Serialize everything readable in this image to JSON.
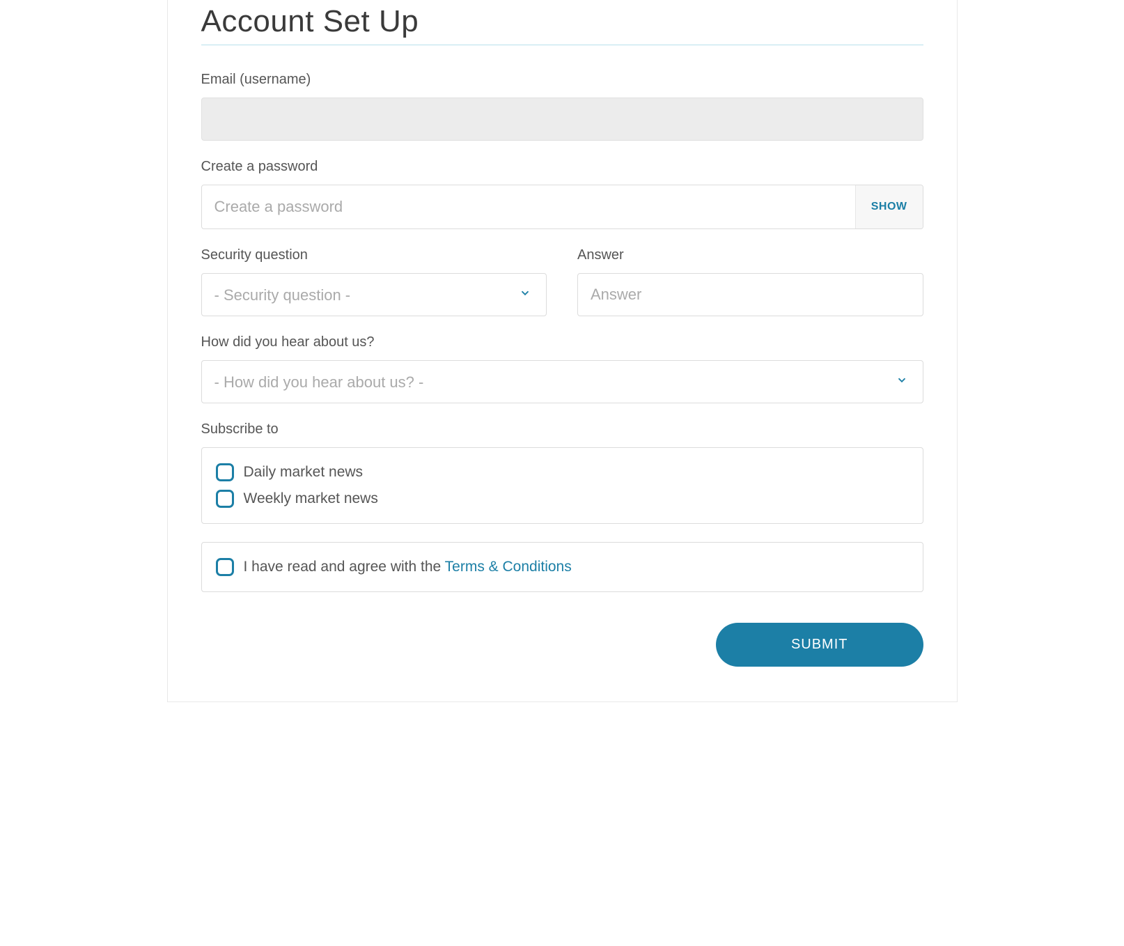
{
  "title": "Account Set Up",
  "email": {
    "label": "Email (username)",
    "value": ""
  },
  "password": {
    "label": "Create a password",
    "placeholder": "Create a password",
    "show_button": "SHOW"
  },
  "security_question": {
    "label": "Security question",
    "placeholder": "- Security question -"
  },
  "answer": {
    "label": "Answer",
    "placeholder": "Answer"
  },
  "hear_about": {
    "label": "How did you hear about us?",
    "placeholder": "- How did you hear about us? -"
  },
  "subscribe": {
    "label": "Subscribe to",
    "options": {
      "daily": "Daily market news",
      "weekly": "Weekly market news"
    }
  },
  "terms": {
    "text_prefix": "I have read and agree with the ",
    "link_text": "Terms & Conditions"
  },
  "submit_label": "SUBMIT"
}
